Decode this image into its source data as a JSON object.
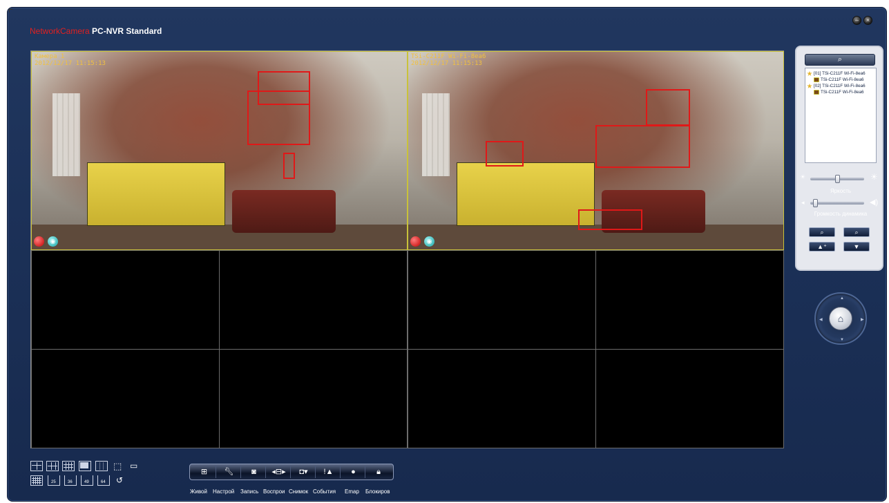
{
  "app": {
    "brand": "NetworkCamera",
    "product": "PC-NVR Standard",
    "window_buttons": [
      "minimize-icon",
      "close-icon"
    ]
  },
  "cameras": [
    {
      "name": "Камера 1",
      "timestamp": "2012/12/17 11:15:13"
    },
    {
      "name": "TSi-C211F Wi-Fi-8ea6",
      "timestamp": "2012/12/17 11:15:13"
    }
  ],
  "device_tree": [
    {
      "label": "[01] TSi-C211F Wi-Fi-8ea6",
      "level": 0,
      "icon": "device-group-icon"
    },
    {
      "label": "TSi-C211F Wi-Fi-8ea6",
      "level": 1,
      "icon": "camera-icon"
    },
    {
      "label": "[02] TSi-C211F Wi-Fi-8ea6",
      "level": 0,
      "icon": "device-group-icon"
    },
    {
      "label": "TSi-C211F Wi-Fi-8ea6",
      "level": 1,
      "icon": "camera-icon"
    }
  ],
  "sliders": {
    "brightness_label": "Яркость",
    "brightness_value": 0.5,
    "volume_label": "Громкость динамика",
    "volume_value": 0.05
  },
  "layouts": {
    "numbered": [
      "25",
      "36",
      "49",
      "64"
    ]
  },
  "toolbar": {
    "items": [
      {
        "label": "Живой",
        "icon": "live-view-icon"
      },
      {
        "label": "Настрой",
        "icon": "settings-wrench-icon"
      },
      {
        "label": "Запись",
        "icon": "record-icon"
      },
      {
        "label": "Воспрои",
        "icon": "playback-icon"
      },
      {
        "label": "Снимок",
        "icon": "snapshot-icon"
      },
      {
        "label": "События",
        "icon": "events-alarm-icon"
      },
      {
        "label": "Emap",
        "icon": "globe-icon"
      },
      {
        "label": "Блокиров",
        "icon": "lock-icon"
      }
    ]
  },
  "colors": {
    "brand_red": "#e02020",
    "background": "#1c3158",
    "osd_text": "#f0c040",
    "motion_box": "#e01818"
  }
}
